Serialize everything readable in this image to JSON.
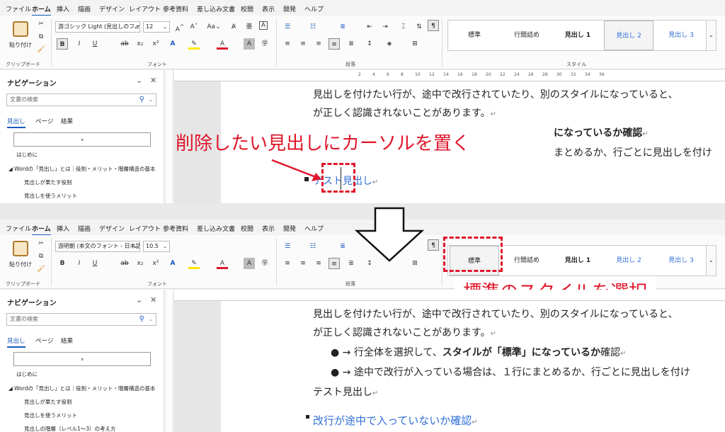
{
  "menu": [
    "ファイル",
    "ホーム",
    "挿入",
    "描画",
    "デザイン",
    "レイアウト",
    "参考資料",
    "差し込み文書",
    "校閲",
    "表示",
    "開発",
    "ヘルプ"
  ],
  "ribbon": {
    "clipboard_label": "クリップボード",
    "paste_label": "貼り付け",
    "font_label": "フォント",
    "paragraph_label": "段落",
    "styles_label": "スタイル",
    "font_size": "12",
    "font_size_2": "10.5",
    "font_name_1": "游ゴシック Light (見出しのフォン",
    "font_name_2": "游明朝 (本文のフォント - 日本語)",
    "styles": [
      "標準",
      "行間詰め",
      "見出し 1",
      "見出し 2",
      "見出し 3"
    ],
    "colors": {
      "accent": "#185abd",
      "annotation": "#e0162b",
      "heading_blue": "#2f6fd6"
    }
  },
  "nav": {
    "title": "ナビゲーション",
    "search_placeholder": "文書の検索",
    "tabs": [
      "見出し",
      "ページ",
      "結果"
    ],
    "collapse_glyph": "⌅",
    "items_top": [
      "はじめに",
      "Wordの「見出し」とは｜役割・メリット・階層構造の基本",
      "見出しが果たす役割",
      "見出しを使うメリット"
    ],
    "item_extra": "見出しの階層（レベル1〜3）の考え方"
  },
  "ruler_ticks": [
    "2",
    "4",
    "6",
    "8",
    "10",
    "12",
    "14",
    "16",
    "18",
    "20",
    "22",
    "24",
    "26",
    "28",
    "30",
    "32",
    "34",
    "36"
  ],
  "doc_top": {
    "line1": "見出しを付けたい行が、途中で改行されていたり、別のスタイルになっていると、",
    "line2": "が正しく認識されないことがあります。",
    "line3_partial": "になっているか確認",
    "line4_partial": "まとめるか、行ごとに見出しを付け",
    "heading": "テスト見出し"
  },
  "doc_bottom": {
    "line1": "見出しを付けたい行が、途中で改行されていたり、別のスタイルになっていると、",
    "line2": "が正しく認識されないことがあります。",
    "bullet1_a": "● → 行全体を選択して、",
    "bullet1_b": "スタイルが「標準」になっているか",
    "bullet1_c": "確認",
    "bullet2": "● → 途中で改行が入っている場合は、１行にまとめるか、行ごとに見出しを付け",
    "plain": "テスト見出し",
    "heading2": "改行が途中で入っていないか確認"
  },
  "annotations": {
    "top": "削除したい見出しにカーソルを置く",
    "bottom": "標準のスタイルを選択"
  }
}
